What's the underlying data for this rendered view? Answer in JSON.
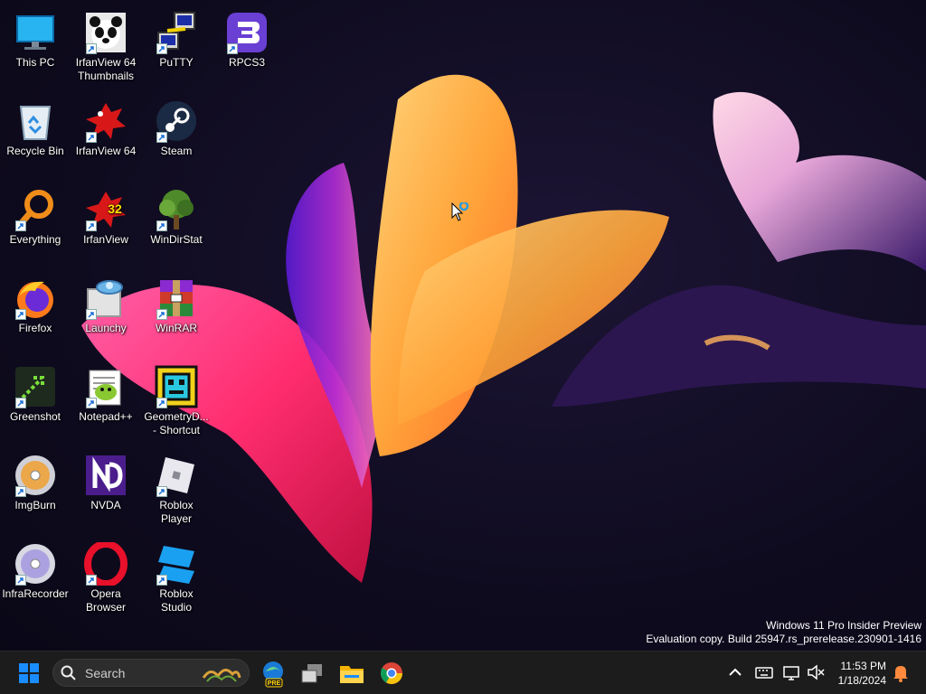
{
  "desktop": {
    "icons": [
      {
        "label": "This PC",
        "icon": "computer-icon"
      },
      {
        "label": "IrfanView 64 Thumbnails",
        "icon": "panda-icon"
      },
      {
        "label": "PuTTY",
        "icon": "putty-icon"
      },
      {
        "label": "RPCS3",
        "icon": "rpcs3-icon"
      },
      {
        "label": "Recycle Bin",
        "icon": "recycle-bin-icon"
      },
      {
        "label": "IrfanView 64",
        "icon": "irfanview-icon"
      },
      {
        "label": "Steam",
        "icon": "steam-icon"
      },
      {
        "label": "Everything",
        "icon": "magnifier-icon"
      },
      {
        "label": "IrfanView",
        "icon": "irfanview-icon"
      },
      {
        "label": "WinDirStat",
        "icon": "tree-icon"
      },
      {
        "label": "Firefox",
        "icon": "firefox-icon"
      },
      {
        "label": "Launchy",
        "icon": "launchy-icon"
      },
      {
        "label": "WinRAR",
        "icon": "winrar-icon"
      },
      {
        "label": "Greenshot",
        "icon": "greenshot-icon"
      },
      {
        "label": "Notepad++",
        "icon": "notepad-icon"
      },
      {
        "label": "GeometryD... - Shortcut",
        "icon": "geometry-dash-icon"
      },
      {
        "label": "ImgBurn",
        "icon": "disc-icon"
      },
      {
        "label": "NVDA",
        "icon": "nvda-icon"
      },
      {
        "label": "Roblox Player",
        "icon": "roblox-icon"
      },
      {
        "label": "InfraRecorder",
        "icon": "disc-icon"
      },
      {
        "label": "Opera Browser",
        "icon": "opera-icon"
      },
      {
        "label": "Roblox Studio",
        "icon": "roblox-studio-icon"
      }
    ],
    "irfanview_badge": "32",
    "watermark": {
      "line1": "Windows 11 Pro Insider Preview",
      "line2": "Evaluation copy. Build 25947.rs_prerelease.230901-1416"
    }
  },
  "taskbar": {
    "search_placeholder": "Search",
    "pinned": [
      {
        "name": "edge-beta-icon",
        "badge": "PRE"
      },
      {
        "name": "task-view-icon"
      },
      {
        "name": "file-explorer-icon"
      },
      {
        "name": "chrome-icon"
      }
    ],
    "clock": {
      "time": "11:53 PM",
      "date": "1/18/2024"
    }
  },
  "colors": {
    "taskbar_bg": "#1c1c1c",
    "windows_blue": "#1a8cff",
    "notification": "#ff8a3d"
  }
}
